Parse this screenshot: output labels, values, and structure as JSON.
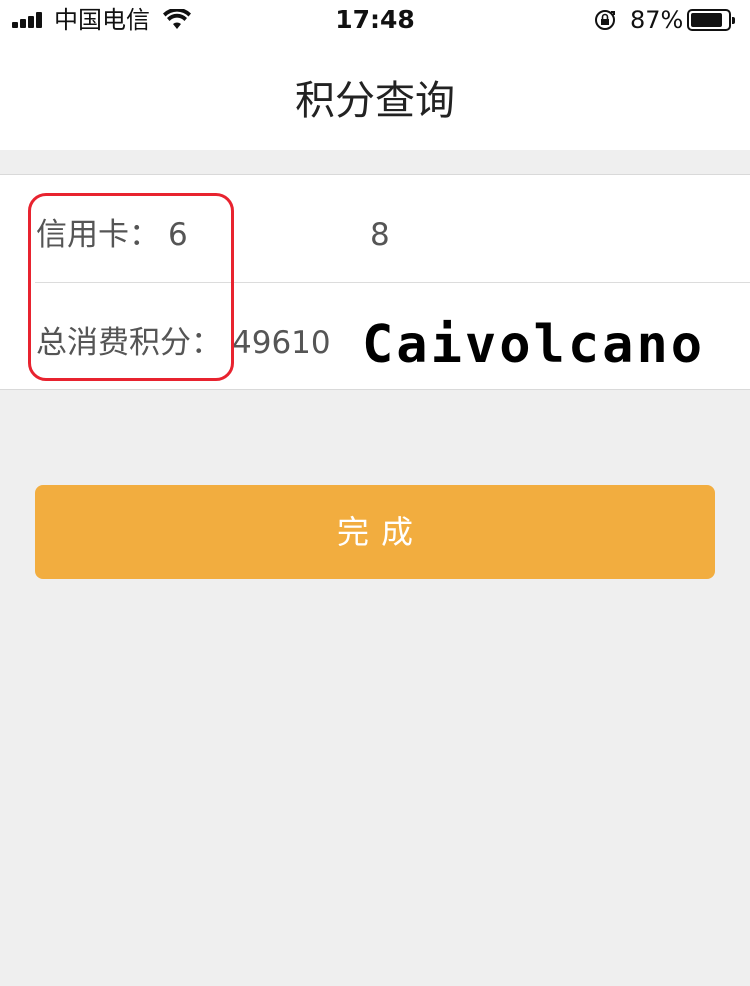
{
  "status_bar": {
    "carrier": "中国电信",
    "time": "17:48",
    "battery_percent": "87%",
    "signal_bars": 4,
    "battery_level": 0.87,
    "icons": [
      "signal-icon",
      "wifi-icon",
      "rotation-lock-icon",
      "battery-icon"
    ]
  },
  "nav": {
    "title": "积分查询"
  },
  "points": {
    "credit_label": "信用卡：",
    "credit_value": "6",
    "credit_value_2": "8",
    "total_label": "总消费积分：",
    "total_value": "49610"
  },
  "watermark": {
    "text": "Caivolcano"
  },
  "actions": {
    "done_label": "完成"
  },
  "colors": {
    "accent": "#f2ad3f",
    "highlight": "#e8232f",
    "background": "#efefef"
  }
}
